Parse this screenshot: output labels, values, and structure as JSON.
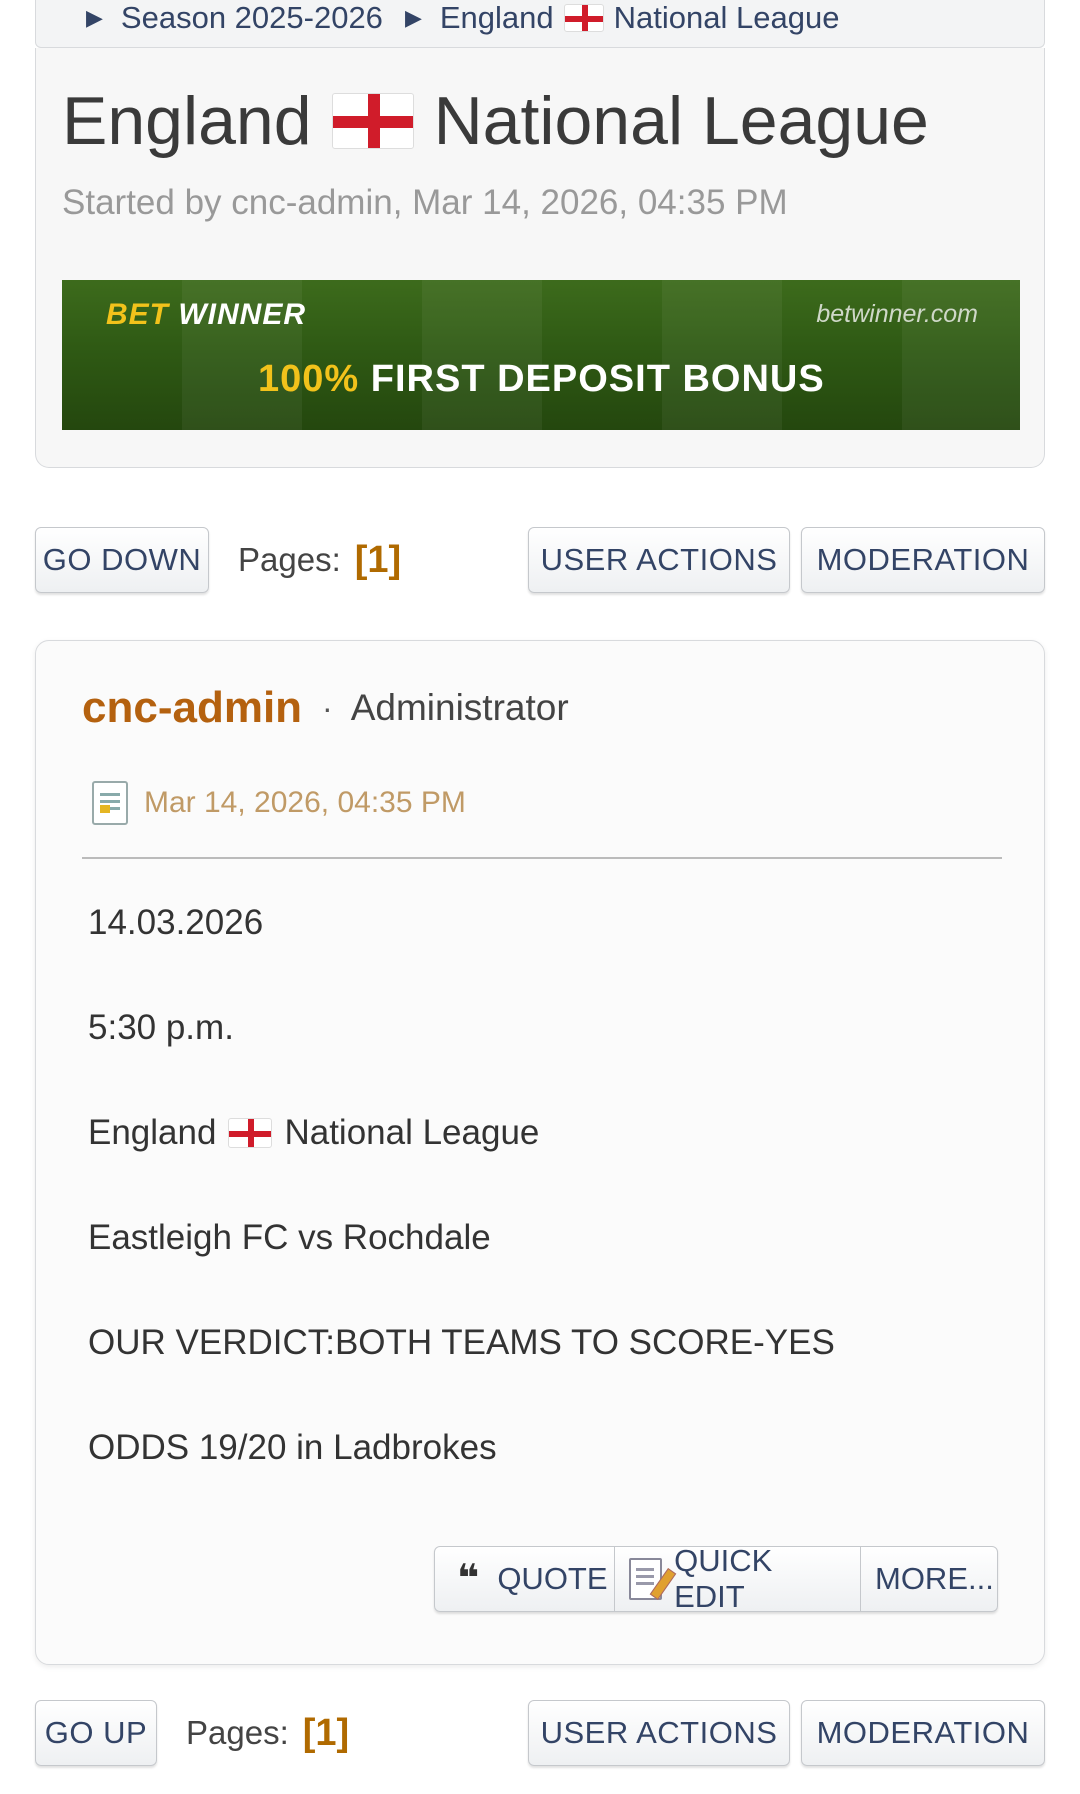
{
  "breadcrumb": {
    "items": [
      "Season 2025-2026",
      "England",
      "National League"
    ]
  },
  "topic": {
    "title_prefix": "England",
    "title_suffix": "National League",
    "started_by": "Started by cnc-admin, Mar 14, 2026, 04:35 PM"
  },
  "banner": {
    "brand_bet": "BET",
    "brand_winner": "WINNER",
    "url": "betwinner.com",
    "promo_pct": "100%",
    "promo_text": "FIRST DEPOSIT BONUS"
  },
  "nav_top": {
    "go_down": "GO DOWN",
    "pages_label": "Pages:",
    "current_page": "[1]",
    "user_actions": "USER ACTIONS",
    "moderation": "MODERATION"
  },
  "post": {
    "author": "cnc-admin",
    "separator": "·",
    "role": "Administrator",
    "date": "Mar 14, 2026, 04:35 PM",
    "lines": {
      "date": "14.03.2026",
      "time": "5:30 p.m.",
      "league_prefix": "England",
      "league_suffix": "National League",
      "match": "Eastleigh FC vs Rochdale",
      "verdict": "OUR VERDICT:BOTH TEAMS TO SCORE-YES",
      "odds": "ODDS 19/20 in Ladbrokes"
    },
    "actions": {
      "quote_glyph": "❝",
      "quote": "QUOTE",
      "quick_edit": "QUICK EDIT",
      "more": "MORE..."
    }
  },
  "nav_bottom": {
    "go_up": "GO UP",
    "pages_label": "Pages:",
    "current_page": "[1]",
    "user_actions": "USER ACTIONS",
    "moderation": "MODERATION"
  },
  "colors": {
    "author": "#b4610f",
    "current_page": "#b06a00",
    "date": "#c09a66",
    "button_text": "#334466",
    "flag_red": "#d01c2a"
  }
}
